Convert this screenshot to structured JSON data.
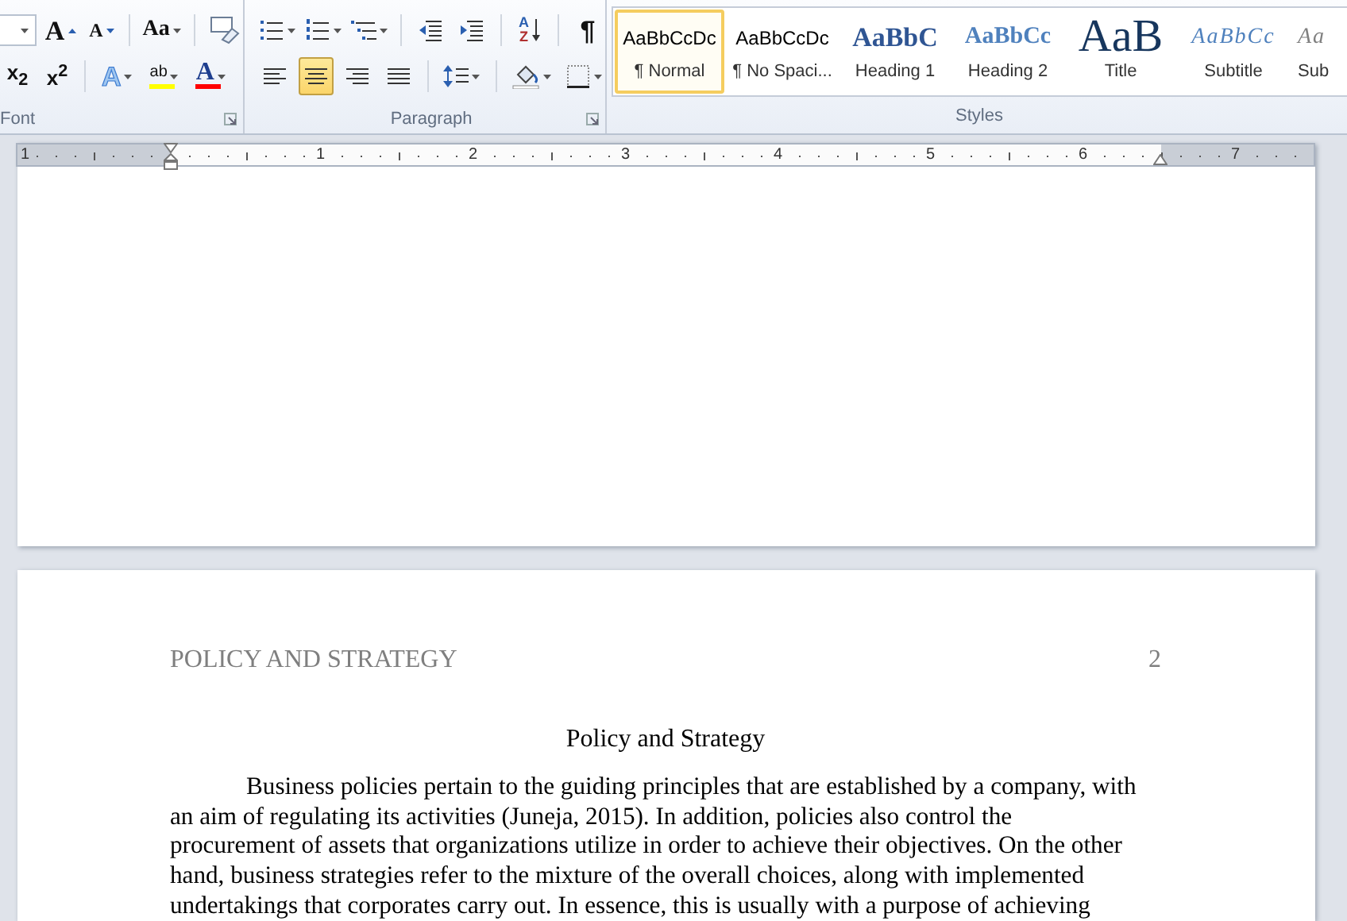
{
  "ribbon": {
    "groups": [
      {
        "label": "Font",
        "rows": [
          [
            {
              "kind": "size-field"
            },
            {
              "kind": "grow-font",
              "text": "A",
              "selected": false
            },
            {
              "kind": "shrink-font",
              "text": "A",
              "selected": false
            },
            {
              "kind": "divider"
            },
            {
              "kind": "change-case",
              "text": "Aa",
              "selected": false
            },
            {
              "kind": "divider"
            },
            {
              "kind": "clear-format",
              "selected": false
            }
          ],
          [
            {
              "kind": "subscript",
              "text": "x$_{2}$",
              "selected": false
            },
            {
              "kind": "superscript",
              "text": "x$^{2}$",
              "selected": false
            },
            {
              "kind": "divider"
            },
            {
              "kind": "text-effects",
              "text": "A",
              "selected": false
            },
            {
              "kind": "highlight",
              "text": "ab",
              "color": "#ffff00",
              "selected": false
            },
            {
              "kind": "font-color",
              "text": "A",
              "color": "#ff0000",
              "selected": false
            }
          ]
        ]
      },
      {
        "label": "Paragraph",
        "rows": [
          [
            {
              "kind": "bullets",
              "selected": false
            },
            {
              "kind": "numbering",
              "selected": false
            },
            {
              "kind": "multilevel",
              "selected": false
            },
            {
              "kind": "divider"
            },
            {
              "kind": "outdent",
              "selected": false
            },
            {
              "kind": "indent",
              "selected": false
            },
            {
              "kind": "divider"
            },
            {
              "kind": "sort",
              "top": "A",
              "bottom": "Z",
              "selected": false
            },
            {
              "kind": "divider"
            },
            {
              "kind": "pilcrow",
              "text": "¶",
              "selected": false
            }
          ],
          [
            {
              "kind": "align-left",
              "selected": false
            },
            {
              "kind": "align-center",
              "selected": true
            },
            {
              "kind": "align-right",
              "selected": false
            },
            {
              "kind": "justify",
              "selected": false
            },
            {
              "kind": "divider"
            },
            {
              "kind": "line-spacing",
              "selected": false
            },
            {
              "kind": "divider"
            },
            {
              "kind": "shading",
              "selected": false
            },
            {
              "kind": "borders",
              "selected": false
            }
          ]
        ]
      }
    ],
    "styles": {
      "label": "Styles",
      "items": [
        {
          "kind": "normal",
          "preview": "AaBbCcDc",
          "label": "¶ Normal",
          "selected": true
        },
        {
          "kind": "no-spacing",
          "preview": "AaBbCcDc",
          "label": "¶ No Spaci...",
          "selected": false
        },
        {
          "kind": "heading1",
          "preview": "AaBbC",
          "label": "Heading 1",
          "selected": false
        },
        {
          "kind": "heading2",
          "preview": "AaBbCc",
          "label": "Heading 2",
          "selected": false
        },
        {
          "kind": "title",
          "preview": "AaB",
          "label": "Title",
          "selected": false
        },
        {
          "kind": "subtitle",
          "preview": "AaBbCc",
          "label": "Subtitle",
          "selected": false
        },
        {
          "kind": "subtle",
          "preview": "Aa",
          "label": "Sub",
          "selected": false
        }
      ]
    }
  },
  "ruler": {
    "numbers": [
      "1",
      "1",
      "2",
      "3",
      "4",
      "5",
      "6",
      "7"
    ]
  },
  "pages": [
    {
      "kind": "blank"
    },
    {
      "kind": "text",
      "header": "POLICY AND STRATEGY",
      "page_number": "2",
      "title": "Policy and Strategy",
      "lines": [
        "Business policies pertain to the guiding principles that are established by a company, with",
        "an aim of regulating its activities (Juneja, 2015). In addition, policies also control the",
        "procurement of assets that organizations utilize in order to achieve their objectives. On the other",
        "hand, business strategies refer to the mixture of the overall choices, along with implemented",
        "undertakings that corporates carry out. In essence, this is usually with a purpose of achieving"
      ]
    }
  ]
}
